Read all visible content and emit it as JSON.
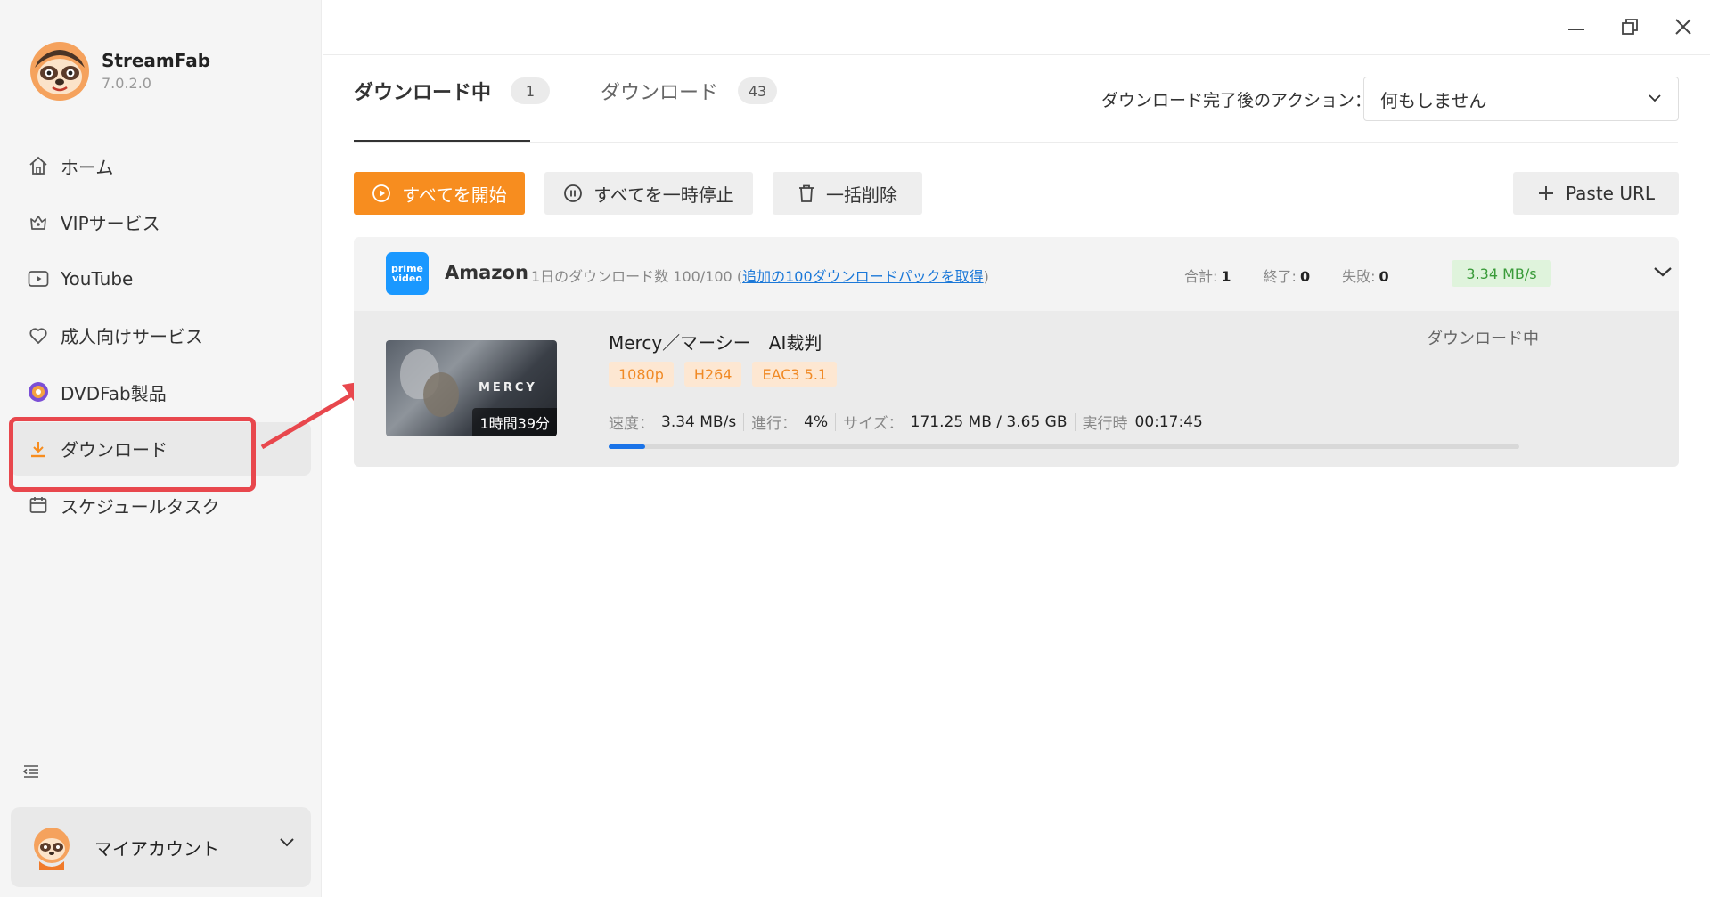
{
  "app": {
    "name": "StreamFab",
    "version": "7.0.2.0"
  },
  "sidebar": {
    "items": [
      {
        "label": "ホーム",
        "icon": "home-icon"
      },
      {
        "label": "VIPサービス",
        "icon": "vip-crown-icon"
      },
      {
        "label": "YouTube",
        "icon": "youtube-icon"
      },
      {
        "label": "成人向けサービス",
        "icon": "heart-icon"
      },
      {
        "label": "DVDFab製品",
        "icon": "dvdfab-logo-icon"
      },
      {
        "label": "ダウンロード",
        "icon": "download-icon"
      },
      {
        "label": "スケジュールタスク",
        "icon": "calendar-icon"
      }
    ],
    "active_index": 5,
    "account_label": "マイアカウント"
  },
  "tabs": [
    {
      "label": "ダウンロード中",
      "count": "1"
    },
    {
      "label": "ダウンロード",
      "count": "43"
    }
  ],
  "after_action": {
    "label": "ダウンロード完了後のアクション：",
    "selected": "何もしません"
  },
  "toolbar": {
    "start_all": "すべてを開始",
    "pause_all": "すべてを一時停止",
    "delete_all": "一括削除",
    "paste_url": "Paste URL"
  },
  "group": {
    "service_icon_text_1": "prime",
    "service_icon_text_2": "video",
    "name": "Amazon",
    "quota_prefix": "1日のダウンロード数 100/100 (",
    "quota_link": "追加の100ダウンロードパックを取得",
    "quota_suffix": ")",
    "stats": {
      "total_label": "合計:",
      "total": "1",
      "done_label": "終了:",
      "done": "0",
      "failed_label": "失敗:",
      "failed": "0"
    },
    "speed": "3.34 MB/s"
  },
  "item": {
    "title": "Mercy／マーシー　AI裁判",
    "thumb_title": "MERCY",
    "duration": "1時間39分",
    "tags": [
      "1080p",
      "H264",
      "EAC3 5.1"
    ],
    "status": "ダウンロード中",
    "speed_label": "速度：",
    "speed": "3.34 MB/s",
    "progress_label": "進行：",
    "progress": "4%",
    "progress_fraction": 0.04,
    "size_label": "サイズ：",
    "size": "171.25 MB / 3.65 GB",
    "elapsed_label": "実行時",
    "elapsed": "00:17:45"
  },
  "colors": {
    "accent_orange": "#f78d1f",
    "highlight_red": "#e8474d",
    "progress_blue": "#1a73e8",
    "speed_green": "#3a9b3a",
    "link_blue": "#1b78d8"
  }
}
